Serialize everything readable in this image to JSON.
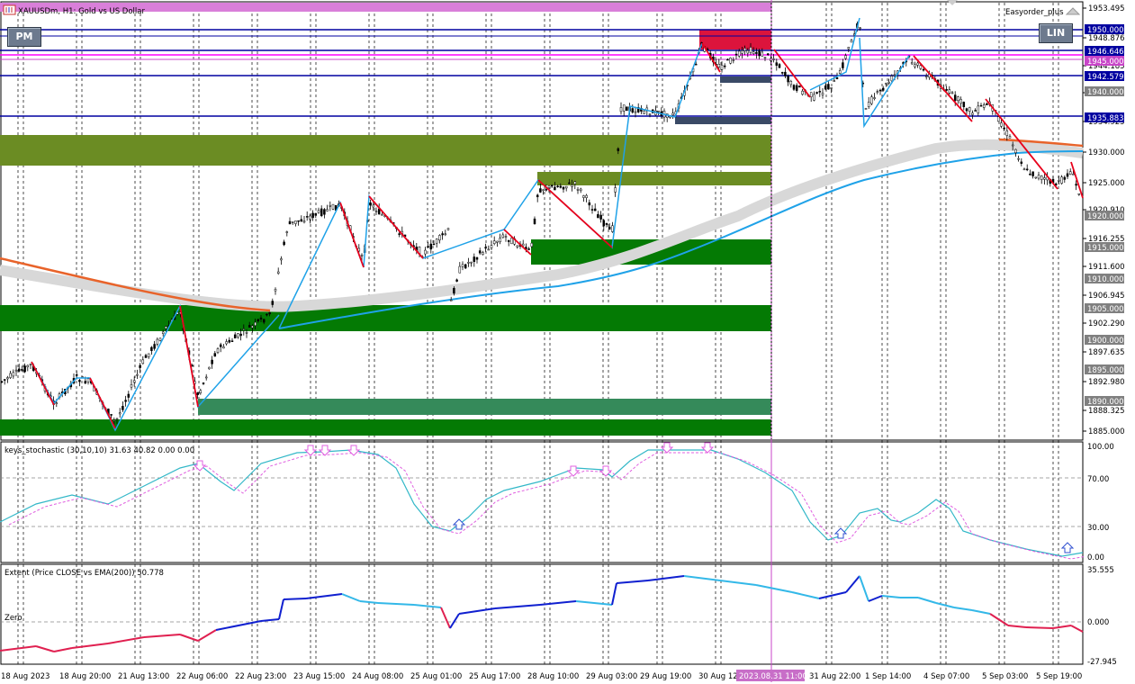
{
  "window": {
    "title": "XAUUSDm, H1:  Gold vs US Dollar",
    "expert": "Easyorder_plus"
  },
  "buttons": {
    "left": "PM",
    "right": "LIN"
  },
  "price_axis": {
    "labels": [
      "1953.495",
      "1948.876",
      "1944.185",
      "1939.555",
      "1934.925",
      "1930.000",
      "1925.000",
      "1920.910",
      "1916.255",
      "1911.600",
      "1906.945",
      "1902.290",
      "1897.635",
      "1892.980",
      "1888.325",
      "1885.000"
    ],
    "hline_labels": [
      "1950.000",
      "1946.646",
      "1945.000",
      "1942.579",
      "1935.883",
      "1940.000",
      "1920.000",
      "1915.000",
      "1910.000",
      "1905.000",
      "1900.000",
      "1895.000",
      "1890.000"
    ]
  },
  "stoch": {
    "title": "keys_stochastic (30,10,10) 31.63 40.82 0.00 0.00",
    "scale": [
      "100.00",
      "70.00",
      "30.00",
      "0.00"
    ]
  },
  "extent": {
    "title": "Extent (Price CLOSE vs EMA(200)) 50.778",
    "zero_label": "Zero",
    "scale": [
      "35.555",
      "0.000",
      "-27.945"
    ]
  },
  "time_axis": {
    "labels": [
      "18 Aug 2023",
      "18 Aug 20:00",
      "21 Aug 13:00",
      "22 Aug 06:00",
      "22 Aug 23:00",
      "23 Aug 15:00",
      "24 Aug 08:00",
      "25 Aug 01:00",
      "25 Aug 17:00",
      "28 Aug 10:00",
      "29 Aug 03:00",
      "29 Aug 19:00",
      "30 Aug 12:00",
      "31 Aug 22:00",
      "1 Sep 14:00",
      "4 Sep 07:00",
      "5 Sep 03:00",
      "5 Sep 19:00"
    ],
    "cursor_label": "2023.08.31 11:00"
  },
  "colors": {
    "accent": "#c846c8",
    "zone_green": "#047a04",
    "zone_olive": "#6b8c23",
    "zone_red": "#dc143c",
    "hline": "#0000a0",
    "ma_blue": "#1fa2e8",
    "ma_orange": "#e8632a"
  }
}
